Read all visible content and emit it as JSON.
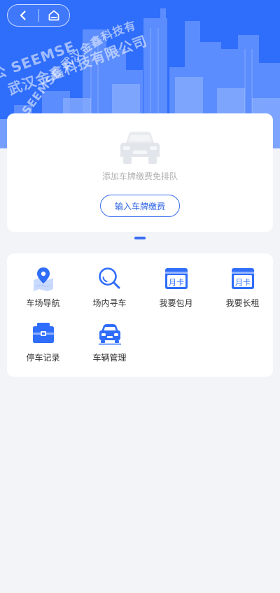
{
  "watermark": {
    "line1": "公 SEEMSE",
    "line2": "武汉金鑫科技有限公司",
    "curved": "SEEMSE 武汉金鑫科技有限公司"
  },
  "nav": {
    "back_icon": "chevron-left-icon",
    "home_icon": "home-icon"
  },
  "plate": {
    "hint": "添加车牌缴费免排队",
    "button": "输入车牌缴费"
  },
  "menu": {
    "items": [
      {
        "label": "车场导航",
        "icon": "map-pin-icon"
      },
      {
        "label": "场内寻车",
        "icon": "search-icon"
      },
      {
        "label": "我要包月",
        "icon": "monthly-card-icon",
        "badge": "月卡"
      },
      {
        "label": "我要长租",
        "icon": "monthly-card-icon",
        "badge": "月卡"
      },
      {
        "label": "停车记录",
        "icon": "briefcase-icon"
      },
      {
        "label": "车辆管理",
        "icon": "car-icon"
      }
    ]
  },
  "colors": {
    "primary": "#2f6dfb",
    "background": "#f3f4f8",
    "card": "#ffffff",
    "text": "#333333",
    "hint": "#b2b2b2"
  }
}
